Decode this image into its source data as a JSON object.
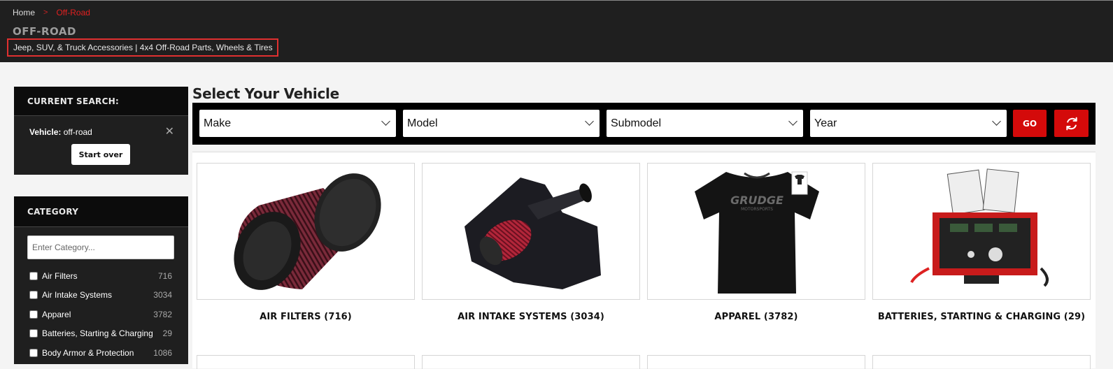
{
  "breadcrumb": {
    "home": "Home",
    "current": "Off-Road"
  },
  "page": {
    "title": "OFF-ROAD",
    "subtitle": "Jeep, SUV, & Truck Accessories | 4x4 Off-Road Parts, Wheels & Tires"
  },
  "current_search": {
    "heading": "CURRENT SEARCH:",
    "vehicle_label": "Vehicle:",
    "vehicle_value": "off-road",
    "start_over": "Start over"
  },
  "category": {
    "heading": "CATEGORY",
    "placeholder": "Enter Category...",
    "items": [
      {
        "label": "Air Filters",
        "count": "716"
      },
      {
        "label": "Air Intake Systems",
        "count": "3034"
      },
      {
        "label": "Apparel",
        "count": "3782"
      },
      {
        "label": "Batteries, Starting & Charging",
        "count": "29"
      },
      {
        "label": "Body Armor & Protection",
        "count": "1086"
      }
    ]
  },
  "vehicle_selector": {
    "title": "Select Your Vehicle",
    "make": "Make",
    "model": "Model",
    "submodel": "Submodel",
    "year": "Year",
    "go": "GO"
  },
  "products": [
    {
      "title": "AIR FILTERS (716)",
      "image": "air-filter-image"
    },
    {
      "title": "AIR INTAKE SYSTEMS (3034)",
      "image": "air-intake-image"
    },
    {
      "title": "APPAREL (3782)",
      "image": "tshirt-image",
      "shirt_text": "GRUDGE",
      "shirt_subtext": "MOTORSPORTS"
    },
    {
      "title": "BATTERIES, STARTING & CHARGING (29)",
      "image": "battery-tester-image"
    }
  ],
  "colors": {
    "accent": "#d40a0a",
    "header_bg": "#1f1f1f",
    "panel_head": "#0c0c0c"
  }
}
